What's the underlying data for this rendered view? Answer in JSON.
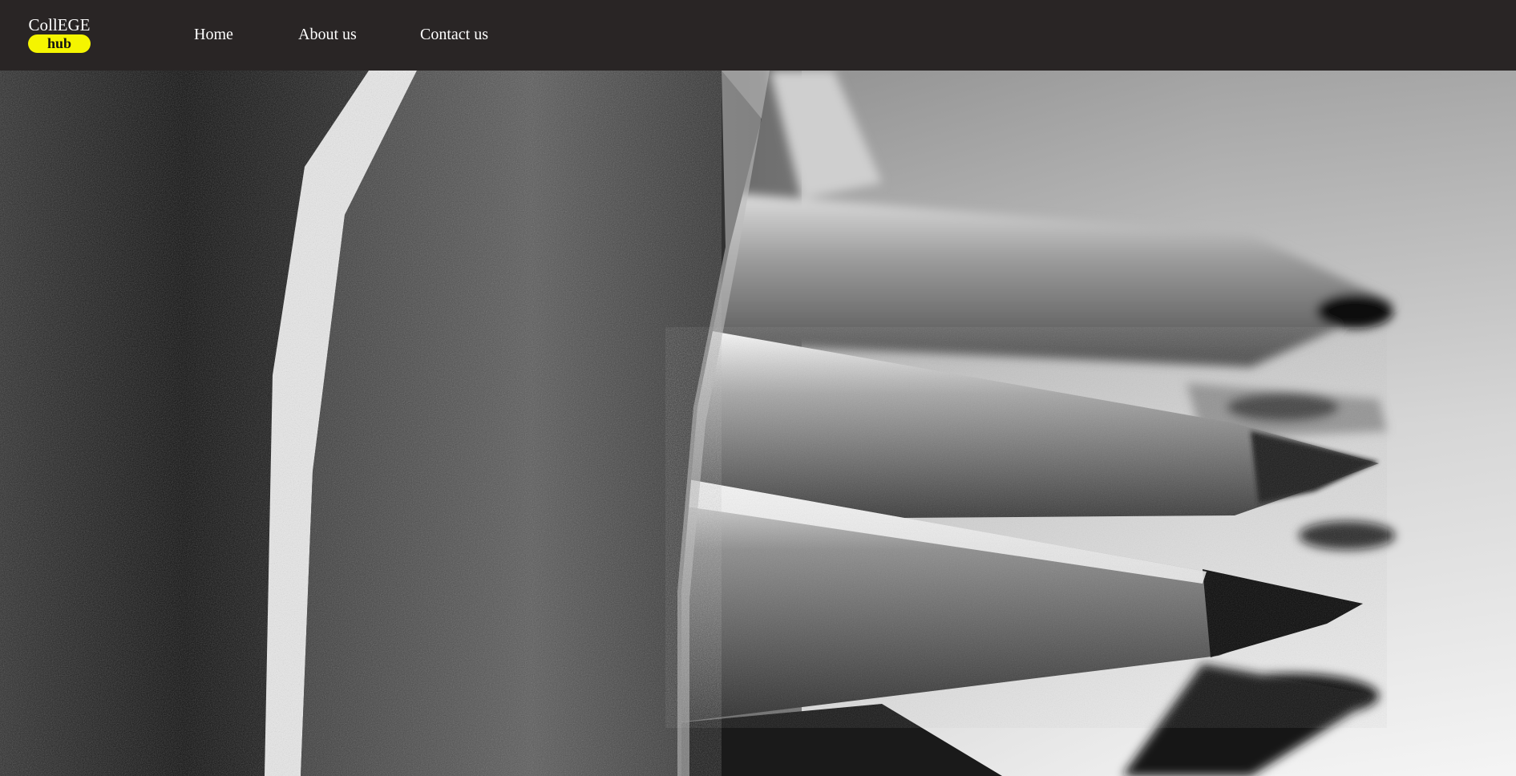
{
  "brand": {
    "line1": "CollEGE",
    "line2": "hub",
    "pill_color": "#f5f500",
    "nav_bg": "#292525"
  },
  "nav": {
    "items": [
      {
        "label": "Home"
      },
      {
        "label": "About us"
      },
      {
        "label": "Contact us"
      }
    ]
  },
  "hero": {
    "subject": "black-and-white macro photo of sharpened pencils",
    "tone": "grayscale"
  }
}
